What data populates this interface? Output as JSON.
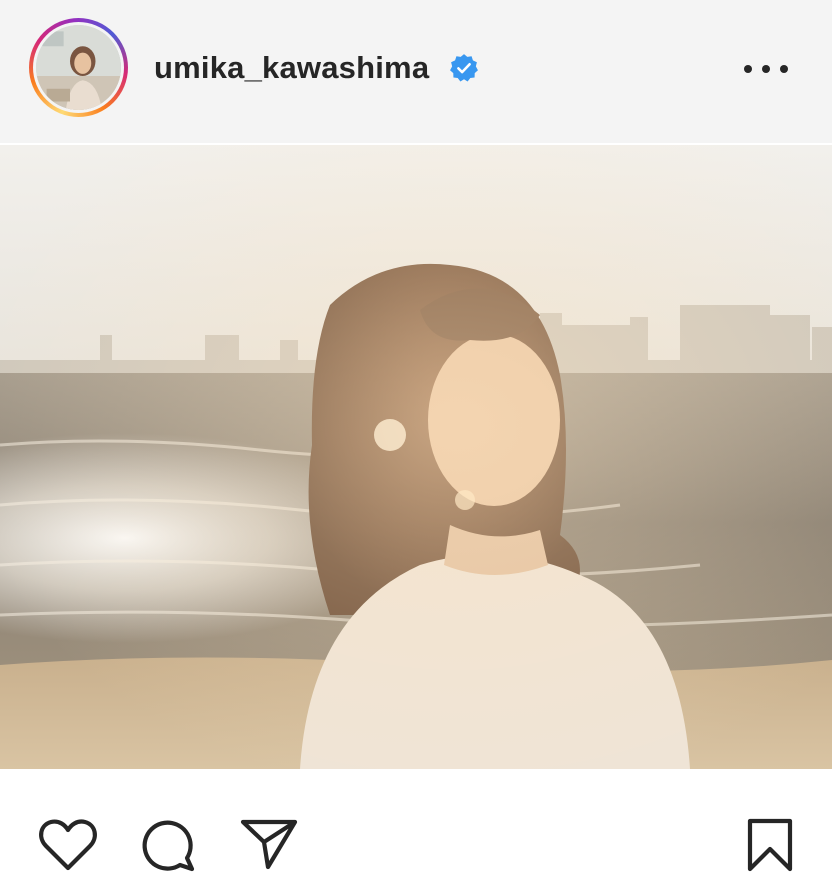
{
  "post": {
    "username": "umika_kawashima",
    "verified": true,
    "icons": {
      "verified": "verified-badge-icon",
      "more": "more-options-icon",
      "like": "heart-icon",
      "comment": "comment-icon",
      "share": "paper-plane-icon",
      "save": "bookmark-icon"
    },
    "colors": {
      "text": "#262626",
      "verified_badge": "#3897f0",
      "header_bg": "#f4f4f4"
    }
  }
}
